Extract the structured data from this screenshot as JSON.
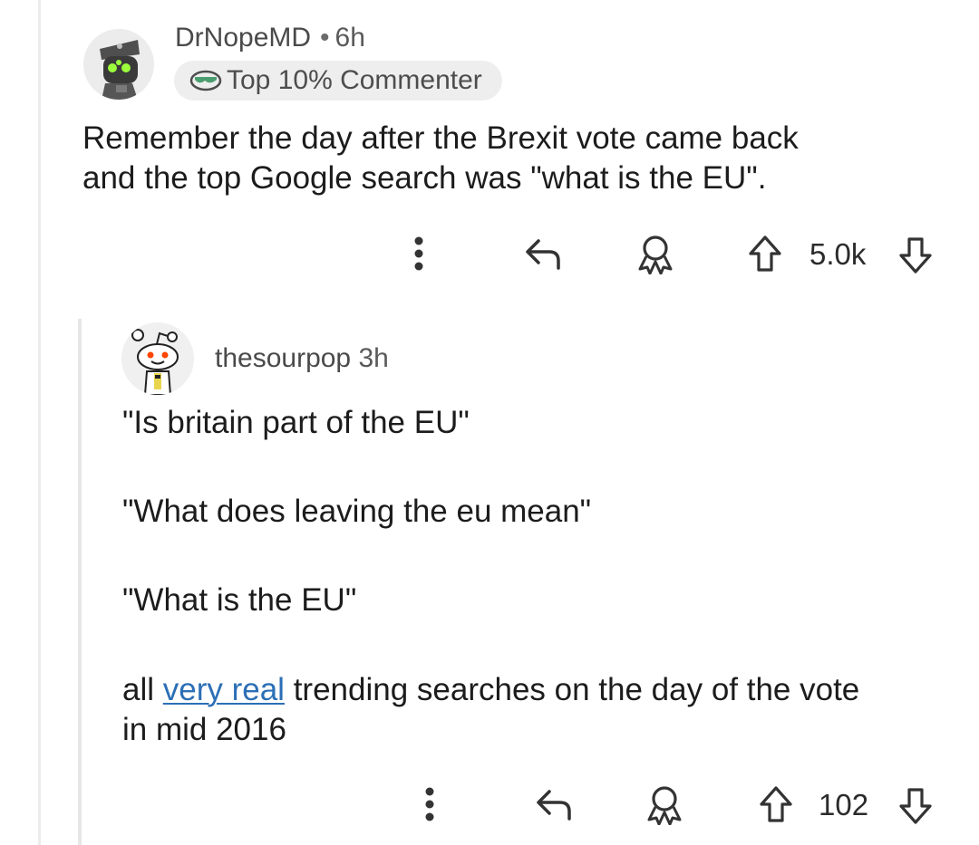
{
  "comment": {
    "author": "DrNopeMD",
    "separator": "•",
    "time": "6h",
    "flair": "Top 10% Commenter",
    "flair_icon": "sunglasses-icon",
    "avatar_icon": "avatar-robot-hat-icon",
    "body_lines": [
      "Remember the day after the Brexit vote came back",
      "and the top Google search was \"what is the EU\"."
    ],
    "actions": {
      "more_icon": "more-vertical-icon",
      "reply_icon": "reply-icon",
      "award_icon": "award-icon",
      "upvote_icon": "upvote-arrow-icon",
      "downvote_icon": "downvote-arrow-icon",
      "score": "5.0k"
    }
  },
  "reply": {
    "author": "thesourpop",
    "time": "3h",
    "avatar_icon": "avatar-snoo-icon",
    "paragraphs": [
      "\"Is britain part of the EU\"",
      "\"What does leaving the eu mean\"",
      "\"What is the EU\""
    ],
    "final_paragraph": {
      "prefix": "all ",
      "link_text": "very real",
      "suffix_line1": " trending searches on the day of the vote",
      "line2": "in mid 2016"
    },
    "actions": {
      "more_icon": "more-vertical-icon",
      "reply_icon": "reply-icon",
      "award_icon": "award-icon",
      "upvote_icon": "upvote-arrow-icon",
      "downvote_icon": "downvote-arrow-icon",
      "score": "102"
    }
  },
  "colors": {
    "link": "#2c6fb6",
    "text": "#1c1c1c",
    "muted": "#4a4a4a",
    "flair_bg": "#eeeeee"
  }
}
